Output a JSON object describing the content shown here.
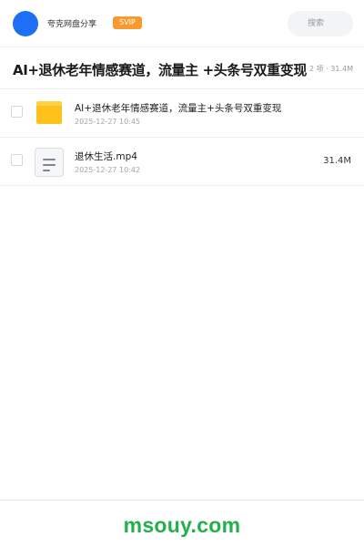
{
  "header": {
    "app_name": "夸克网盘分享",
    "vip_badge": "SVIP",
    "search_placeholder": "搜索",
    "avatar_color": "#1e6ff5",
    "vip_color": "#f79a2f"
  },
  "share": {
    "title": "AI+退休老年情感赛道，流量主 +头条号双重变现",
    "meta": "2 项 · 31.4M"
  },
  "files": [
    {
      "type": "folder",
      "icon": "folder-icon",
      "name": "AI+退休老年情感赛道，流量主+头条号双重变现",
      "date": "2025-12-27 10:45",
      "size": ""
    },
    {
      "type": "video",
      "icon": "video-file-icon",
      "name": "退休生活.mp4",
      "date": "2025-12-27 10:42",
      "size": "31.4M"
    }
  ],
  "footer": {
    "watermark": "msouy.com",
    "watermark_color": "#22b04b"
  }
}
